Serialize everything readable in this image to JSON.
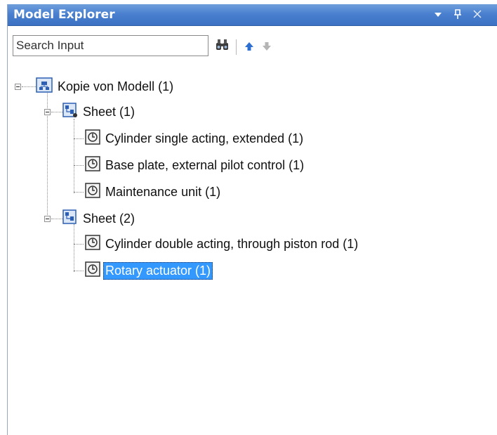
{
  "panel": {
    "title": "Model Explorer",
    "buttons": {
      "dropdown": "▾",
      "pin": "⊥",
      "close": "✕"
    }
  },
  "toolbar": {
    "search_placeholder": "Search Input",
    "search_value": "",
    "icons": [
      "binoculars-icon",
      "arrow-up-icon",
      "arrow-down-icon"
    ]
  },
  "tree": {
    "root": {
      "label": "Kopie von Modell (1)",
      "icon": "model-icon",
      "expanded": true
    },
    "sheets": [
      {
        "label": "Sheet (1)",
        "icon": "sheet-icon",
        "expanded": true,
        "items": [
          {
            "label": "Cylinder single acting, extended (1)",
            "icon": "component-icon"
          },
          {
            "label": "Base plate, external pilot control (1)",
            "icon": "component-icon"
          },
          {
            "label": "Maintenance unit (1)",
            "icon": "component-icon"
          }
        ]
      },
      {
        "label": "Sheet (2)",
        "icon": "sheet-icon",
        "expanded": true,
        "items": [
          {
            "label": "Cylinder double acting, through piston rod (1)",
            "icon": "component-icon"
          },
          {
            "label": "Rotary actuator (1)",
            "icon": "component-icon",
            "selected": true
          }
        ]
      }
    ]
  },
  "colors": {
    "titlebar": "#4a80cf",
    "selection": "#3399ff",
    "selection_text": "#ffffff",
    "icon_blue": "#2c5fb3"
  }
}
